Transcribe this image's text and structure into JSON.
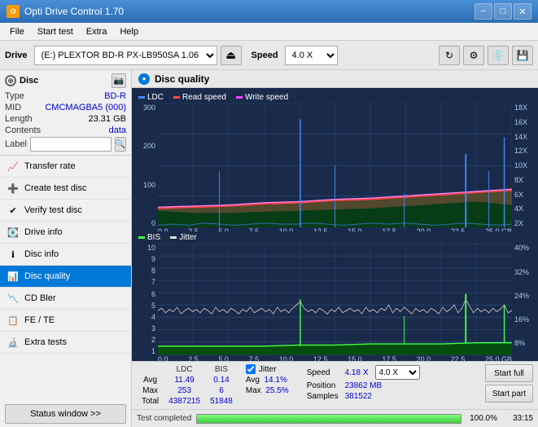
{
  "titleBar": {
    "icon": "O",
    "title": "Opti Drive Control 1.70",
    "minimizeLabel": "−",
    "maximizeLabel": "□",
    "closeLabel": "✕"
  },
  "menuBar": {
    "items": [
      "File",
      "Start test",
      "Extra",
      "Help"
    ]
  },
  "toolbar": {
    "driveLabel": "Drive",
    "driveValue": "(E:) PLEXTOR BD-R  PX-LB950SA 1.06",
    "speedLabel": "Speed",
    "speedValue": "4.0 X"
  },
  "disc": {
    "header": "Disc",
    "typeLabel": "Type",
    "typeValue": "BD-R",
    "midLabel": "MID",
    "midValue": "CMCMAGBA5 (000)",
    "lengthLabel": "Length",
    "lengthValue": "23.31 GB",
    "contentsLabel": "Contents",
    "contentsValue": "data",
    "labelLabel": "Label",
    "labelValue": ""
  },
  "navItems": [
    {
      "id": "transfer-rate",
      "label": "Transfer rate",
      "active": false
    },
    {
      "id": "create-test-disc",
      "label": "Create test disc",
      "active": false
    },
    {
      "id": "verify-test-disc",
      "label": "Verify test disc",
      "active": false
    },
    {
      "id": "drive-info",
      "label": "Drive info",
      "active": false
    },
    {
      "id": "disc-info",
      "label": "Disc info",
      "active": false
    },
    {
      "id": "disc-quality",
      "label": "Disc quality",
      "active": true
    },
    {
      "id": "cd-bler",
      "label": "CD Bler",
      "active": false
    },
    {
      "id": "fe-te",
      "label": "FE / TE",
      "active": false
    },
    {
      "id": "extra-tests",
      "label": "Extra tests",
      "active": false
    }
  ],
  "statusButton": "Status window >>",
  "qualityHeader": "Disc quality",
  "chart1": {
    "legend": [
      {
        "label": "LDC",
        "color": "#4444ff"
      },
      {
        "label": "Read speed",
        "color": "#ff4444"
      },
      {
        "label": "Write speed",
        "color": "#ff44ff"
      }
    ],
    "yAxisLeft": [
      "300",
      "200",
      "100",
      "0"
    ],
    "yAxisRight": [
      "18X",
      "16X",
      "14X",
      "12X",
      "10X",
      "8X",
      "6X",
      "4X",
      "2X"
    ],
    "xAxisLabels": [
      "0.0",
      "2.5",
      "5.0",
      "7.5",
      "10.0",
      "12.5",
      "15.0",
      "17.5",
      "20.0",
      "22.5",
      "25.0 GB"
    ]
  },
  "chart2": {
    "legend": [
      {
        "label": "BIS",
        "color": "#44ff44"
      },
      {
        "label": "Jitter",
        "color": "#ffffff"
      }
    ],
    "yAxisLeft": [
      "10",
      "9",
      "8",
      "7",
      "6",
      "5",
      "4",
      "3",
      "2",
      "1"
    ],
    "yAxisRight": [
      "40%",
      "32%",
      "24%",
      "16%",
      "8%"
    ],
    "xAxisLabels": [
      "0.0",
      "2.5",
      "5.0",
      "7.5",
      "10.0",
      "12.5",
      "15.0",
      "17.5",
      "20.0",
      "22.5",
      "25.0 GB"
    ]
  },
  "stats": {
    "columns": [
      "",
      "LDC",
      "BIS"
    ],
    "rows": [
      {
        "label": "Avg",
        "ldc": "11.49",
        "bis": "0.14"
      },
      {
        "label": "Max",
        "ldc": "253",
        "bis": "6"
      },
      {
        "label": "Total",
        "ldc": "4387215",
        "bis": "51848"
      }
    ],
    "jitter": {
      "checked": true,
      "label": "Jitter",
      "avg": "14.1%",
      "max": "25.5%"
    },
    "speedLabel": "Speed",
    "speedValue": "4.18 X",
    "speedSelect": "4.0 X",
    "positionLabel": "Position",
    "positionValue": "23862 MB",
    "samplesLabel": "Samples",
    "samplesValue": "381522",
    "startFullButton": "Start full",
    "startPartButton": "Start part"
  },
  "progressBar": {
    "statusText": "Test completed",
    "percent": 100,
    "percentText": "100.0%",
    "timeText": "33:15"
  }
}
